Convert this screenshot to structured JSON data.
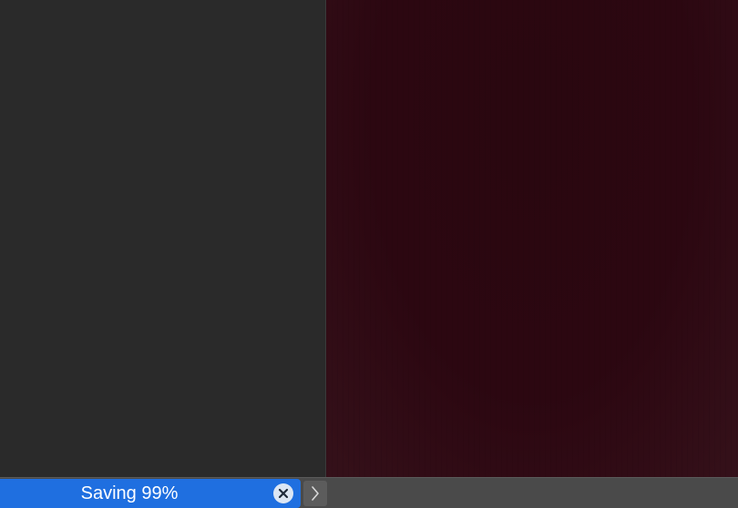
{
  "status_bar": {
    "progress_label": "Saving 99%",
    "progress_fraction": 0.99,
    "cancel_icon": "close-circle-icon",
    "expand_icon": "chevron-right-icon"
  },
  "colors": {
    "progress_accent": "#1f6fe0",
    "preview_background": "#2c0711",
    "panel_background": "#2a2a2a",
    "status_bar_background": "#4a4a4a"
  }
}
